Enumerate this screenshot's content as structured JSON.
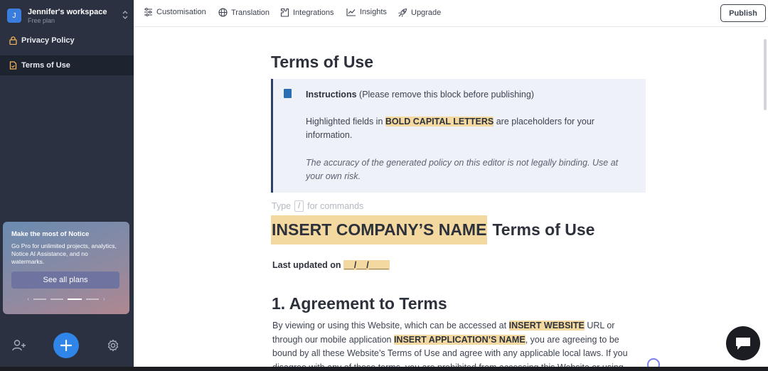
{
  "workspace": {
    "avatar": "J",
    "name": "Jennifer's workspace",
    "plan": "Free plan"
  },
  "sidebar": {
    "items": [
      {
        "label": "Privacy Policy",
        "icon": "lock-icon",
        "active": false
      },
      {
        "label": "Terms of Use",
        "icon": "document-icon",
        "active": true
      }
    ],
    "promo": {
      "title": "Make the most of Notice",
      "body": "Go Pro for unlimited projects, analytics, Notice AI Assistance, and no watermarks.",
      "button": "See all plans",
      "prev": "‹",
      "next": "›"
    }
  },
  "topbar": {
    "items": [
      {
        "label": "Customisation",
        "icon": "sliders-icon"
      },
      {
        "label": "Translation",
        "icon": "globe-icon"
      },
      {
        "label": "Integrations",
        "icon": "puzzle-icon"
      },
      {
        "label": "Insights",
        "icon": "chart-icon"
      },
      {
        "label": "Upgrade",
        "icon": "rocket-icon"
      }
    ],
    "publish": "Publish"
  },
  "document": {
    "title": "Terms of Use",
    "instructions": {
      "label": "Instructions",
      "note": "(Please remove this block before publishing)",
      "line1_pre": "Highlighted fields in",
      "line1_hl": "BOLD CAPITAL LETTERS",
      "line1_post": "are placeholders for your",
      "line2": "information.",
      "line3": "The accuracy of the generated policy on this editor is not legally binding. Use at",
      "line4": "your own risk."
    },
    "command_hint": {
      "pre": "Type",
      "key": "/",
      "post": "for commands"
    },
    "heading_placeholder": "INSERT COMPANY’S NAME",
    "heading_rest": "Terms of Use",
    "last_updated_label": "Last updated on",
    "last_updated_value": "__/__/____",
    "section1_title": "1. Agreement to Terms",
    "section1": {
      "t1": "By viewing or using this Website, which can be accessed at",
      "hl1": "INSERT WEBSITE",
      "t2": "URL or through our mobile application",
      "hl2": "INSERT APPLICATION’S NAME",
      "t3": ", you are agreeing to be bound by all these Website’s Terms of Use and agree with any applicable local laws. If you disagree with any of these terms, you are prohibited from accessing this Website or using"
    }
  },
  "colors": {
    "sidebar_bg": "#2b3140",
    "accent": "#2f86e8",
    "highlight": "#f3d9a0"
  }
}
